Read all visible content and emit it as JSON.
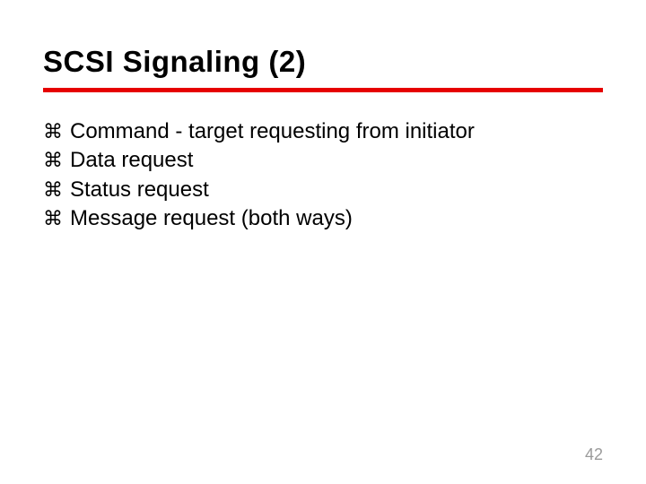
{
  "title": "SCSI Signaling (2)",
  "bullet_glyph": "⌘",
  "bullets": [
    "Command - target requesting from initiator",
    "Data request",
    "Status request",
    "Message request (both ways)"
  ],
  "page_number": "42"
}
